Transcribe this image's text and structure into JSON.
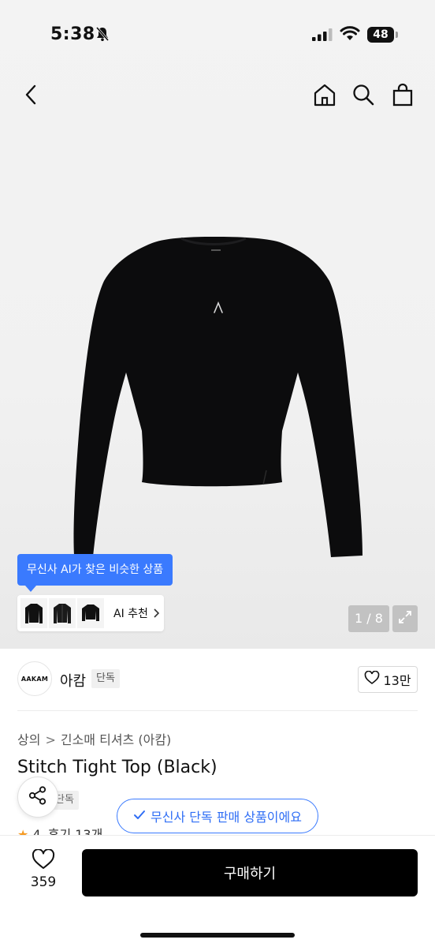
{
  "status_bar": {
    "time": "5:38",
    "battery": "48"
  },
  "nav": {
    "back_icon": "chevron-left-icon",
    "home_icon": "home-icon",
    "search_icon": "search-icon",
    "cart_icon": "shopping-bag-icon"
  },
  "gallery": {
    "ai_tooltip": "무신사 AI가 찾은 비슷한 상품",
    "ai_recommend_label": "AI 추천",
    "counter": "1 / 8"
  },
  "brand": {
    "logo_text": "AAKAM",
    "name": "아캄",
    "exclusive_badge": "단독",
    "like_count": "13만"
  },
  "breadcrumb": {
    "category": "상의",
    "subcategory": "긴소매 티셔츠 (아캄)"
  },
  "product": {
    "title": "Stitch Tight Top (Black)",
    "badge": "단독",
    "exclusive_notice": "무신사 단독 판매 상품이에요",
    "rating": "4",
    "review_text": "후기 13개"
  },
  "bottom_bar": {
    "wish_count": "359",
    "buy_label": "구매하기"
  },
  "colors": {
    "accent_blue": "#3a7afe",
    "buy_button": "#000000",
    "star": "#f59a23"
  }
}
